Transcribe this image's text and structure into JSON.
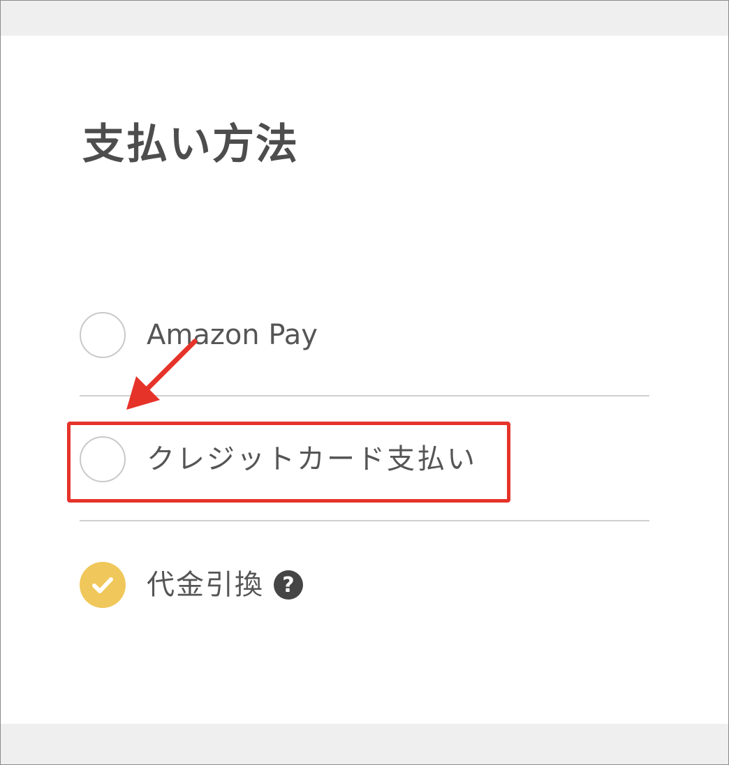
{
  "page": {
    "title": "支払い方法"
  },
  "payment_options": [
    {
      "label": "Amazon Pay",
      "selected": false
    },
    {
      "label": "クレジットカード支払い",
      "selected": false
    },
    {
      "label": "代金引換",
      "selected": true
    }
  ],
  "help_icon": {
    "icon": "question-circle-icon",
    "glyph": "?"
  },
  "colors": {
    "selected_radio": "#f0c75a",
    "highlight": "#e5332a",
    "title_text": "#4d4d4d"
  },
  "annotations": {
    "highlight_target": "クレジットカード支払い",
    "arrow": "red-arrow-pointing-to-credit-card-option"
  }
}
